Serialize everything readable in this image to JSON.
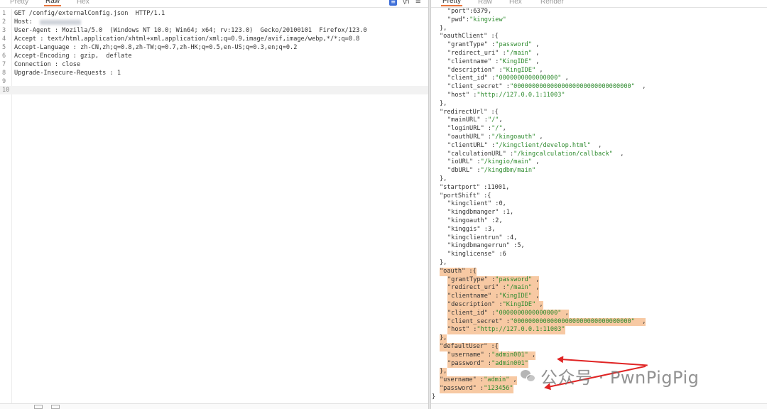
{
  "request_pane": {
    "tabs": [
      "Pretty",
      "Raw",
      "Hex"
    ],
    "active_tab": "Raw",
    "tool_icons": [
      "message-icon",
      "newline-icon",
      "menu-icon"
    ],
    "tool_glyphs": [
      "≡",
      "\\n",
      "≡"
    ],
    "lines": [
      {
        "num": "1",
        "text": "GET /config/externalConfig.json  HTTP/1.1"
      },
      {
        "num": "2",
        "text": "Host: ",
        "redacted": true
      },
      {
        "num": "3",
        "text": "User-Agent : Mozilla/5.0  (Windows NT 10.0; Win64; x64; rv:123.0)  Gecko/20100101  Firefox/123.0"
      },
      {
        "num": "4",
        "text": "Accept : text/html,application/xhtml+xml,application/xml;q=0.9,image/avif,image/webp,*/*;q=0.8"
      },
      {
        "num": "5",
        "text": "Accept-Language : zh-CN,zh;q=0.8,zh-TW;q=0.7,zh-HK;q=0.5,en-US;q=0.3,en;q=0.2"
      },
      {
        "num": "6",
        "text": "Accept-Encoding : gzip,  deflate"
      },
      {
        "num": "7",
        "text": "Connection : close"
      },
      {
        "num": "8",
        "text": "Upgrade-Insecure-Requests : 1"
      },
      {
        "num": "9",
        "text": ""
      },
      {
        "num": "10",
        "text": ""
      }
    ]
  },
  "response_pane": {
    "tabs": [
      "Pretty",
      "Raw",
      "Hex",
      "Render"
    ],
    "active_tab": "Pretty",
    "lines": [
      {
        "indent": 3,
        "tokens": [
          [
            "k",
            "\"port\""
          ],
          [
            "p",
            ":"
          ],
          [
            "n",
            "6379"
          ],
          [
            "p",
            ","
          ]
        ]
      },
      {
        "indent": 3,
        "tokens": [
          [
            "k",
            "\"pwd\""
          ],
          [
            "p",
            ":"
          ],
          [
            "s",
            "\"kingview\""
          ]
        ]
      },
      {
        "indent": 2,
        "tokens": [
          [
            "p",
            "},"
          ]
        ]
      },
      {
        "indent": 2,
        "tokens": [
          [
            "k",
            "\"oauthClient\""
          ],
          [
            "p",
            " :{"
          ]
        ]
      },
      {
        "indent": 3,
        "tokens": [
          [
            "k",
            "\"grantType\""
          ],
          [
            "p",
            " :"
          ],
          [
            "s",
            "\"password\""
          ],
          [
            "p",
            " ,"
          ]
        ]
      },
      {
        "indent": 3,
        "tokens": [
          [
            "k",
            "\"redirect_uri\""
          ],
          [
            "p",
            " :"
          ],
          [
            "s",
            "\"/main\""
          ],
          [
            "p",
            " ,"
          ]
        ]
      },
      {
        "indent": 3,
        "tokens": [
          [
            "k",
            "\"clientname\""
          ],
          [
            "p",
            " :"
          ],
          [
            "s",
            "\"KingIDE\""
          ],
          [
            "p",
            " ,"
          ]
        ]
      },
      {
        "indent": 3,
        "tokens": [
          [
            "k",
            "\"description\""
          ],
          [
            "p",
            " :"
          ],
          [
            "s",
            "\"KingIDE\""
          ],
          [
            "p",
            " ,"
          ]
        ]
      },
      {
        "indent": 3,
        "tokens": [
          [
            "k",
            "\"client_id\""
          ],
          [
            "p",
            " :"
          ],
          [
            "s",
            "\"0000000000000000\""
          ],
          [
            "p",
            " ,"
          ]
        ]
      },
      {
        "indent": 3,
        "tokens": [
          [
            "k",
            "\"client_secret\""
          ],
          [
            "p",
            " :"
          ],
          [
            "s",
            "\"00000000000000000000000000000000\""
          ],
          [
            "p",
            "  ,"
          ]
        ]
      },
      {
        "indent": 3,
        "tokens": [
          [
            "k",
            "\"host\""
          ],
          [
            "p",
            " :"
          ],
          [
            "s",
            "\"http://127.0.0.1:11003\""
          ]
        ]
      },
      {
        "indent": 2,
        "tokens": [
          [
            "p",
            "},"
          ]
        ]
      },
      {
        "indent": 2,
        "tokens": [
          [
            "k",
            "\"redirectUrl\""
          ],
          [
            "p",
            " :{"
          ]
        ]
      },
      {
        "indent": 3,
        "tokens": [
          [
            "k",
            "\"mainURL\""
          ],
          [
            "p",
            " :"
          ],
          [
            "s",
            "\"/\""
          ],
          [
            "p",
            ","
          ]
        ]
      },
      {
        "indent": 3,
        "tokens": [
          [
            "k",
            "\"loginURL\""
          ],
          [
            "p",
            " :"
          ],
          [
            "s",
            "\"/\""
          ],
          [
            "p",
            ","
          ]
        ]
      },
      {
        "indent": 3,
        "tokens": [
          [
            "k",
            "\"oauthURL\""
          ],
          [
            "p",
            " :"
          ],
          [
            "s",
            "\"/kingoauth\""
          ],
          [
            "p",
            " ,"
          ]
        ]
      },
      {
        "indent": 3,
        "tokens": [
          [
            "k",
            "\"clientURL\""
          ],
          [
            "p",
            " :"
          ],
          [
            "s",
            "\"/kingclient/develop.html\""
          ],
          [
            "p",
            "  ,"
          ]
        ]
      },
      {
        "indent": 3,
        "tokens": [
          [
            "k",
            "\"calculationURL\""
          ],
          [
            "p",
            " :"
          ],
          [
            "s",
            "\"/kingcalculation/callback\""
          ],
          [
            "p",
            "  ,"
          ]
        ]
      },
      {
        "indent": 3,
        "tokens": [
          [
            "k",
            "\"ioURL\""
          ],
          [
            "p",
            " :"
          ],
          [
            "s",
            "\"/kingio/main\""
          ],
          [
            "p",
            " ,"
          ]
        ]
      },
      {
        "indent": 3,
        "tokens": [
          [
            "k",
            "\"dbURL\""
          ],
          [
            "p",
            " :"
          ],
          [
            "s",
            "\"/kingdbm/main\""
          ]
        ]
      },
      {
        "indent": 2,
        "tokens": [
          [
            "p",
            "},"
          ]
        ]
      },
      {
        "indent": 2,
        "tokens": [
          [
            "k",
            "\"startport\""
          ],
          [
            "p",
            " :"
          ],
          [
            "n",
            "11001"
          ],
          [
            "p",
            ","
          ]
        ]
      },
      {
        "indent": 2,
        "tokens": [
          [
            "k",
            "\"portShift\""
          ],
          [
            "p",
            " :{"
          ]
        ]
      },
      {
        "indent": 3,
        "tokens": [
          [
            "k",
            "\"kingclient\""
          ],
          [
            "p",
            " :"
          ],
          [
            "n",
            "0"
          ],
          [
            "p",
            ","
          ]
        ]
      },
      {
        "indent": 3,
        "tokens": [
          [
            "k",
            "\"kingdbmanger\""
          ],
          [
            "p",
            " :"
          ],
          [
            "n",
            "1"
          ],
          [
            "p",
            ","
          ]
        ]
      },
      {
        "indent": 3,
        "tokens": [
          [
            "k",
            "\"kingoauth\""
          ],
          [
            "p",
            " :"
          ],
          [
            "n",
            "2"
          ],
          [
            "p",
            ","
          ]
        ]
      },
      {
        "indent": 3,
        "tokens": [
          [
            "k",
            "\"kinggis\""
          ],
          [
            "p",
            " :"
          ],
          [
            "n",
            "3"
          ],
          [
            "p",
            ","
          ]
        ]
      },
      {
        "indent": 3,
        "tokens": [
          [
            "k",
            "\"kingclientrun\""
          ],
          [
            "p",
            " :"
          ],
          [
            "n",
            "4"
          ],
          [
            "p",
            ","
          ]
        ]
      },
      {
        "indent": 3,
        "tokens": [
          [
            "k",
            "\"kingdbmangerrun\""
          ],
          [
            "p",
            " :"
          ],
          [
            "n",
            "5"
          ],
          [
            "p",
            ","
          ]
        ]
      },
      {
        "indent": 3,
        "tokens": [
          [
            "k",
            "\"kinglicense\""
          ],
          [
            "p",
            " :"
          ],
          [
            "n",
            "6"
          ]
        ]
      },
      {
        "indent": 2,
        "tokens": [
          [
            "p",
            "},"
          ]
        ]
      },
      {
        "indent": 2,
        "hl": true,
        "tokens": [
          [
            "k",
            "\"oauth\""
          ],
          [
            "p",
            " :{"
          ]
        ]
      },
      {
        "indent": 3,
        "hl": true,
        "tokens": [
          [
            "k",
            "\"grantType\""
          ],
          [
            "p",
            " :"
          ],
          [
            "s",
            "\"password\""
          ],
          [
            "p",
            " ,"
          ]
        ]
      },
      {
        "indent": 3,
        "hl": true,
        "tokens": [
          [
            "k",
            "\"redirect_uri\""
          ],
          [
            "p",
            " :"
          ],
          [
            "s",
            "\"/main\""
          ],
          [
            "p",
            " ,"
          ]
        ]
      },
      {
        "indent": 3,
        "hl": true,
        "tokens": [
          [
            "k",
            "\"clientname\""
          ],
          [
            "p",
            " :"
          ],
          [
            "s",
            "\"KingIDE\""
          ],
          [
            "p",
            " ,"
          ]
        ]
      },
      {
        "indent": 3,
        "hl": true,
        "tokens": [
          [
            "k",
            "\"description\""
          ],
          [
            "p",
            " :"
          ],
          [
            "s",
            "\"KingIDE\""
          ],
          [
            "p",
            " ,"
          ]
        ]
      },
      {
        "indent": 3,
        "hl": true,
        "tokens": [
          [
            "k",
            "\"client_id\""
          ],
          [
            "p",
            " :"
          ],
          [
            "s",
            "\"0000000000000000\""
          ],
          [
            "p",
            " ,"
          ]
        ]
      },
      {
        "indent": 3,
        "hl": true,
        "tokens": [
          [
            "k",
            "\"client_secret\""
          ],
          [
            "p",
            " :"
          ],
          [
            "s",
            "\"00000000000000000000000000000000\""
          ],
          [
            "p",
            "  ,"
          ]
        ]
      },
      {
        "indent": 3,
        "hl": true,
        "tokens": [
          [
            "k",
            "\"host\""
          ],
          [
            "p",
            " :"
          ],
          [
            "s",
            "\"http://127.0.0.1:11003\""
          ]
        ]
      },
      {
        "indent": 2,
        "hl": true,
        "tokens": [
          [
            "p",
            "},"
          ]
        ]
      },
      {
        "indent": 2,
        "hl": true,
        "tokens": [
          [
            "k",
            "\"defaultUser\""
          ],
          [
            "p",
            " :{"
          ]
        ]
      },
      {
        "indent": 3,
        "hl": true,
        "tokens": [
          [
            "k",
            "\"username\""
          ],
          [
            "p",
            " :"
          ],
          [
            "s",
            "\"admin001\""
          ],
          [
            "p",
            " ,"
          ]
        ]
      },
      {
        "indent": 3,
        "hl": true,
        "tokens": [
          [
            "k",
            "\"password\""
          ],
          [
            "p",
            " :"
          ],
          [
            "s",
            "\"admin001\""
          ]
        ]
      },
      {
        "indent": 2,
        "hl": true,
        "tokens": [
          [
            "p",
            "},"
          ]
        ]
      },
      {
        "indent": 2,
        "hl": true,
        "tokens": [
          [
            "k",
            "\"username\""
          ],
          [
            "p",
            " :"
          ],
          [
            "s",
            "\"admin\""
          ],
          [
            "p",
            " ,"
          ]
        ]
      },
      {
        "indent": 2,
        "hl": true,
        "tokens": [
          [
            "k",
            "\"password\""
          ],
          [
            "p",
            " :"
          ],
          [
            "s",
            "\"123456\""
          ]
        ]
      },
      {
        "indent": 1,
        "tokens": [
          [
            "p",
            "}"
          ]
        ]
      }
    ]
  },
  "watermark": {
    "text": "公众号 · PwnPigPig"
  },
  "colors": {
    "accent_tab": "#e8743b",
    "string": "#2d8a2d",
    "highlight": "#f7c9a3",
    "arrow": "#e02424"
  }
}
